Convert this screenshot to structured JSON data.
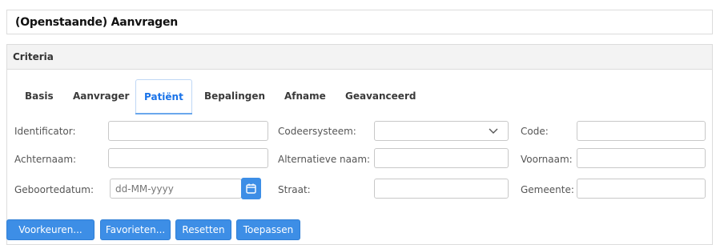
{
  "header": {
    "title": "(Openstaande) Aanvragen"
  },
  "criteria": {
    "title": "Criteria",
    "tabs": [
      {
        "label": "Basis"
      },
      {
        "label": "Aanvrager"
      },
      {
        "label": "Patiënt",
        "active": true
      },
      {
        "label": "Bepalingen"
      },
      {
        "label": "Afname"
      },
      {
        "label": "Geavanceerd"
      }
    ],
    "fields": {
      "identificator": {
        "label": "Identificator:",
        "value": ""
      },
      "codeersysteem": {
        "label": "Codeersysteem:",
        "value": ""
      },
      "code": {
        "label": "Code:",
        "value": ""
      },
      "achternaam": {
        "label": "Achternaam:",
        "value": ""
      },
      "alternatieve_naam": {
        "label": "Alternatieve naam:",
        "value": ""
      },
      "voornaam": {
        "label": "Voornaam:",
        "value": ""
      },
      "geboortedatum": {
        "label": "Geboortedatum:",
        "placeholder": "dd-MM-yyyy",
        "value": ""
      },
      "straat": {
        "label": "Straat:",
        "value": ""
      },
      "gemeente": {
        "label": "Gemeente:",
        "value": ""
      }
    }
  },
  "actions": {
    "voorkeuren": "Voorkeuren...",
    "favorieten": "Favorieten...",
    "resetten": "Resetten",
    "toepassen": "Toepassen"
  },
  "colors": {
    "accent": "#3d8ee6",
    "active_tab_text": "#1a73e8",
    "border": "#dcdcdc"
  },
  "icons": {
    "select_chevron": "chevron-down-icon",
    "date_picker": "calendar-icon"
  }
}
